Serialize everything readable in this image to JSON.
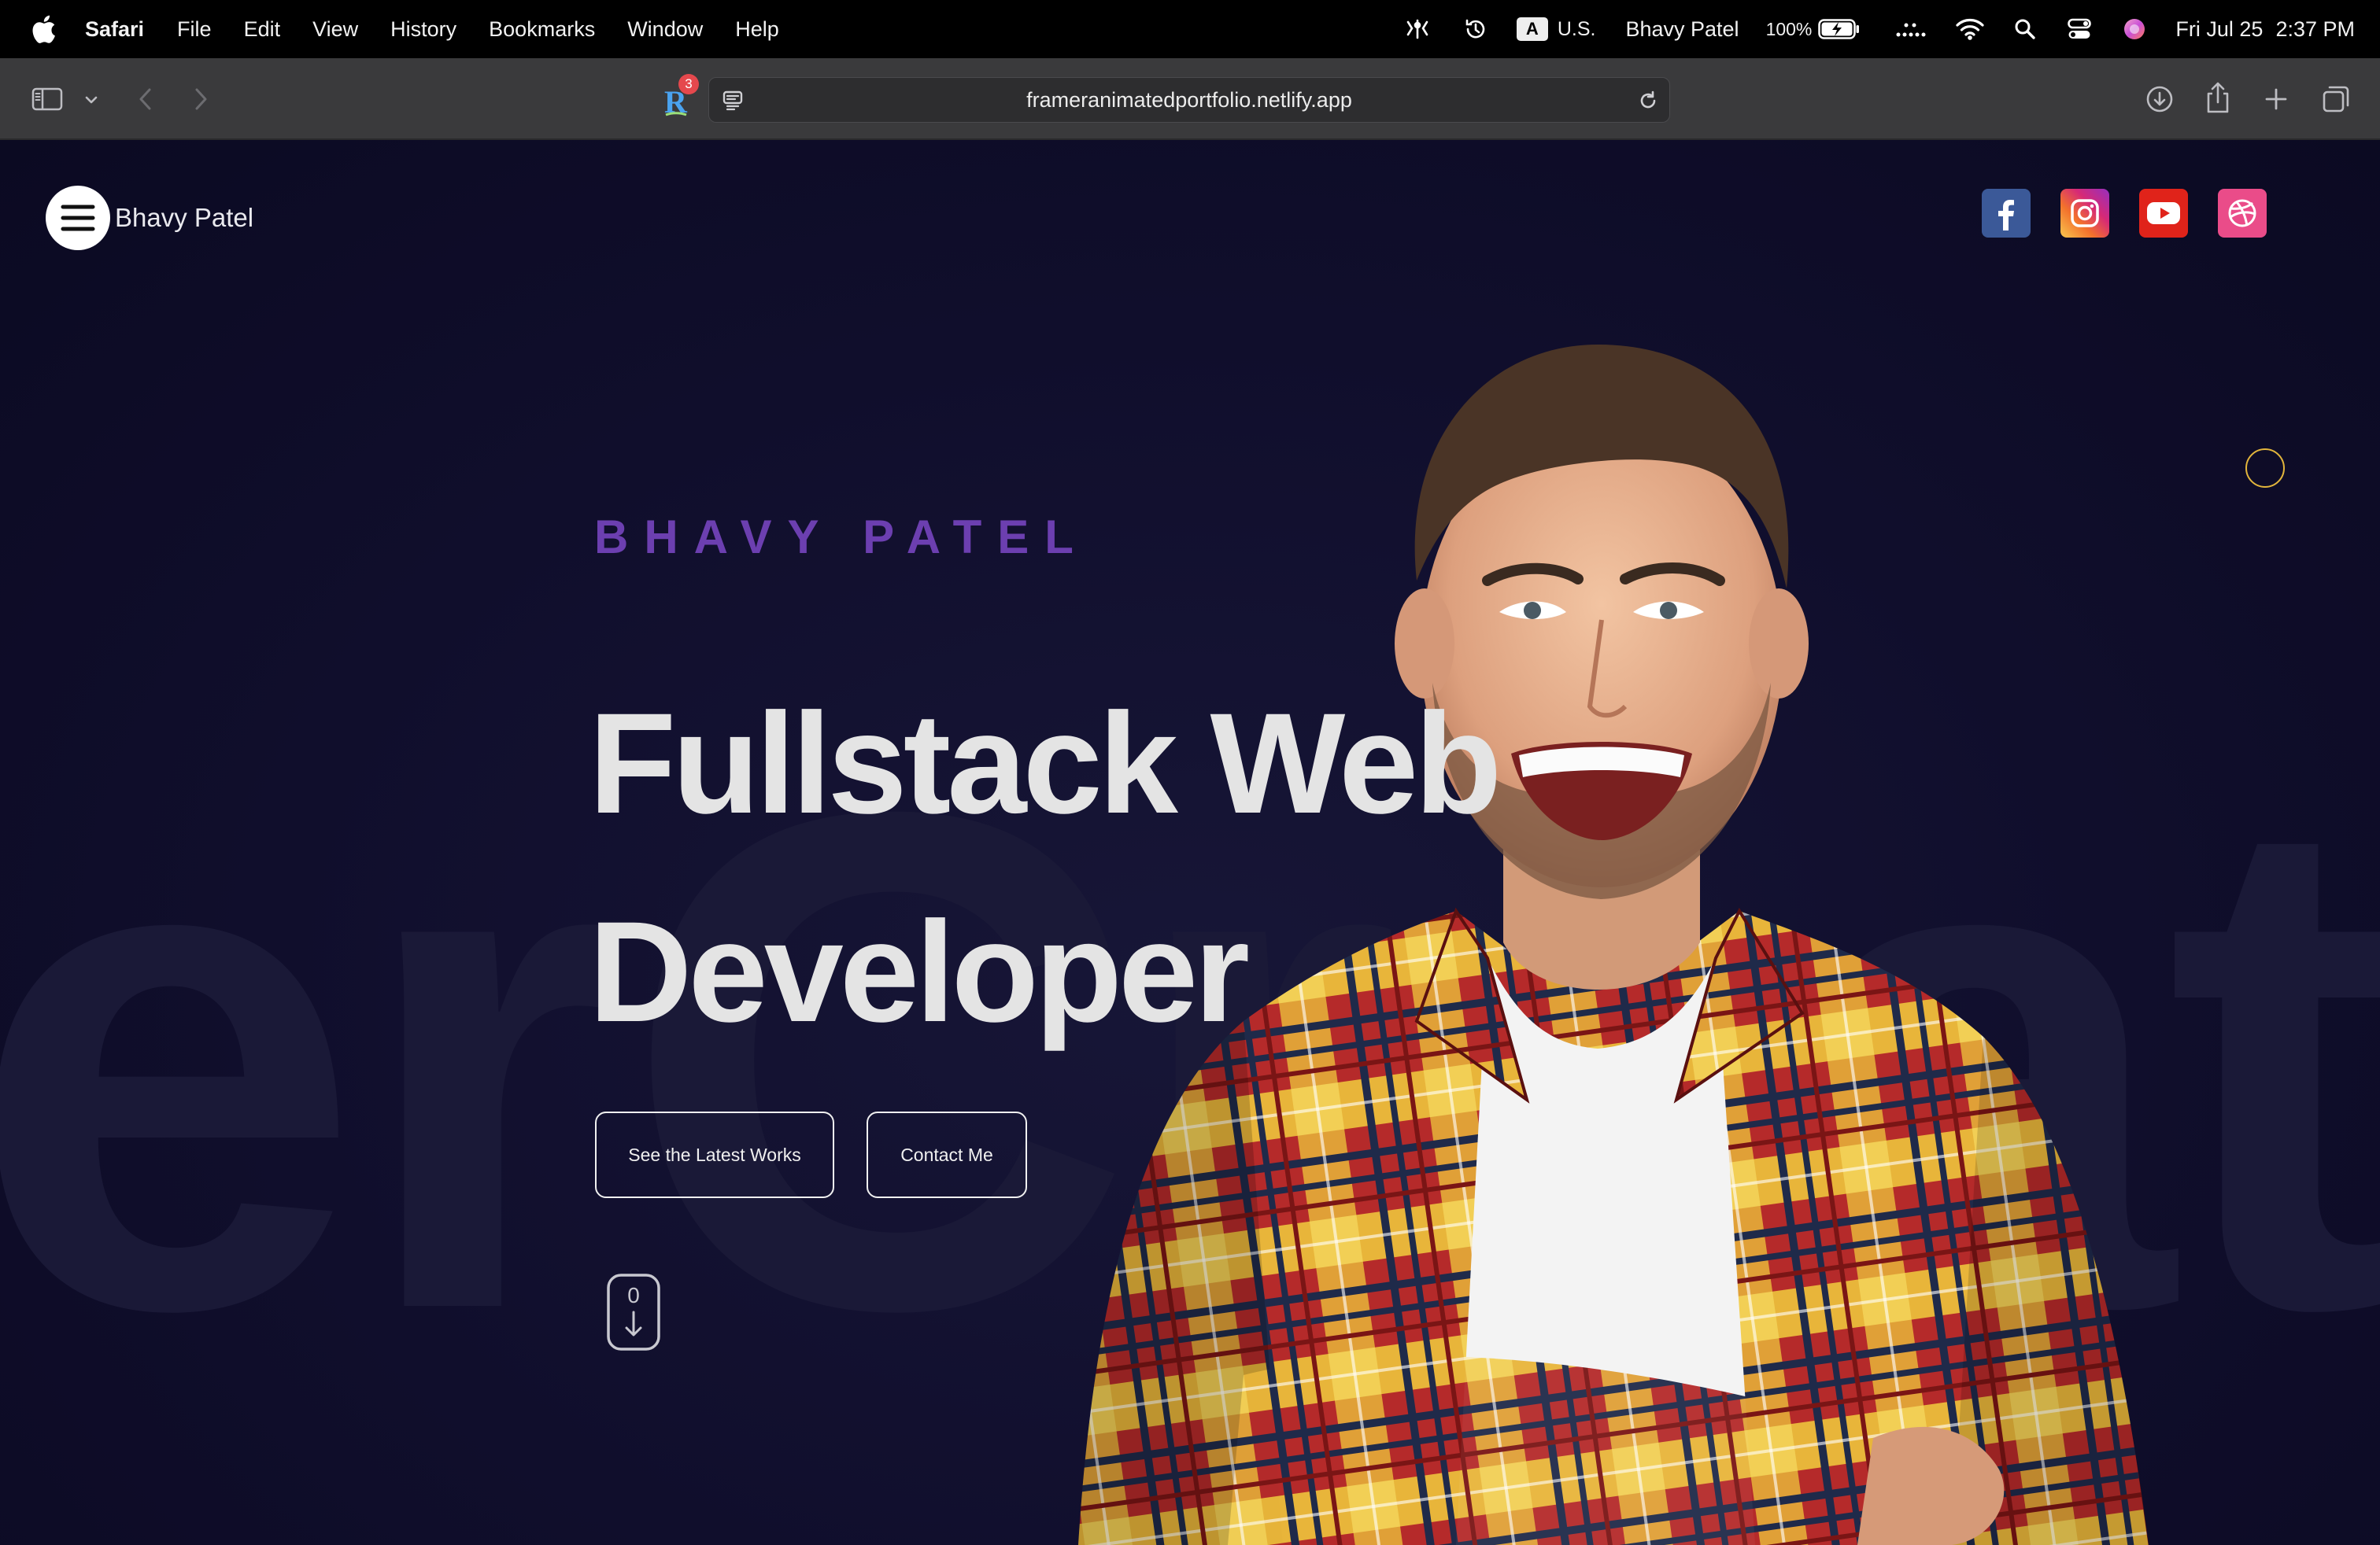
{
  "menubar": {
    "app_name": "Safari",
    "items": [
      "File",
      "Edit",
      "View",
      "History",
      "Bookmarks",
      "Window",
      "Help"
    ],
    "input_source_badge": "A",
    "input_source": "U.S.",
    "user_name": "Bhavy Patel",
    "battery_percent": "100%",
    "date": "Fri Jul 25",
    "time": "2:37 PM"
  },
  "browser": {
    "url": "frameranimatedportfolio.netlify.app",
    "extension_badge_count": "3",
    "extension_letter": "R"
  },
  "site": {
    "brand": "Bhavy Patel",
    "social": [
      "facebook",
      "instagram",
      "youtube",
      "dribbble"
    ],
    "eyebrow": "BHAVY PATEL",
    "headline_line1": "Fullstack Web",
    "headline_line2": "Developer",
    "cta_primary": "See the Latest Works",
    "cta_secondary": "Contact Me",
    "scroll_indicator_digit": "0",
    "background_letters": "erCreato"
  },
  "colors": {
    "page_bg": "#100e2c",
    "eyebrow": "#6c3fb0",
    "headline": "#e4e4e4",
    "facebook": "#3b5998",
    "youtube": "#e0231a",
    "dribbble": "#ea4c89",
    "cursor_ring": "#e2b53c"
  }
}
